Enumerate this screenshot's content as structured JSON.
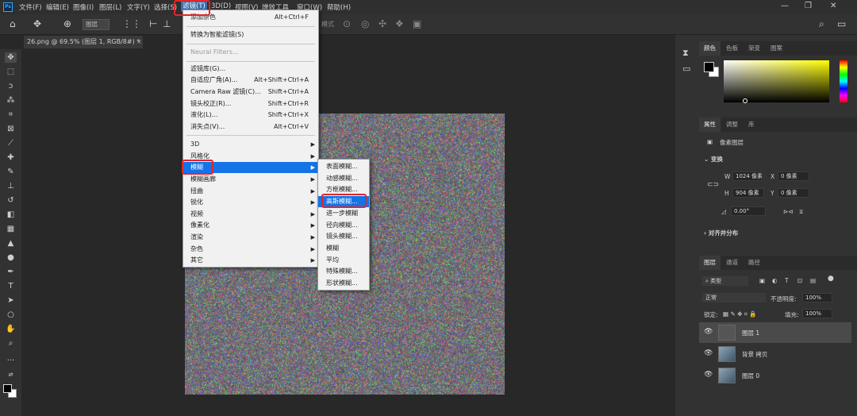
{
  "menubar": {
    "logo": "Ps",
    "items": [
      "文件(F)",
      "编辑(E)",
      "图像(I)",
      "图层(L)",
      "文字(Y)",
      "选择(S)",
      "滤镜(T)",
      "3D(D)",
      "视图(V)",
      "增效工具",
      "窗口(W)",
      "帮助(H)"
    ]
  },
  "options": {
    "sel1": "图层",
    "mode_label": "模式"
  },
  "document": {
    "tab": "26.png @ 69.5% (图层 1, RGB/8#) *",
    "close": "×"
  },
  "filter_menu": {
    "items": [
      {
        "label": "添加杂色",
        "shortcut": "Alt+Ctrl+F"
      },
      {
        "label": "转换为智能滤镜(S)",
        "shortcut": ""
      },
      {
        "label": "Neural Filters...",
        "shortcut": ""
      },
      {
        "label": "滤镜库(G)...",
        "shortcut": ""
      },
      {
        "label": "自适应广角(A)...",
        "shortcut": "Alt+Shift+Ctrl+A"
      },
      {
        "label": "Camera Raw 滤镜(C)...",
        "shortcut": "Shift+Ctrl+A"
      },
      {
        "label": "镜头校正(R)...",
        "shortcut": "Shift+Ctrl+R"
      },
      {
        "label": "液化(L)...",
        "shortcut": "Shift+Ctrl+X"
      },
      {
        "label": "消失点(V)...",
        "shortcut": "Alt+Ctrl+V"
      },
      {
        "label": "3D",
        "shortcut": ""
      },
      {
        "label": "风格化",
        "shortcut": ""
      },
      {
        "label": "模糊",
        "shortcut": ""
      },
      {
        "label": "模糊画廊",
        "shortcut": ""
      },
      {
        "label": "扭曲",
        "shortcut": ""
      },
      {
        "label": "锐化",
        "shortcut": ""
      },
      {
        "label": "视频",
        "shortcut": ""
      },
      {
        "label": "像素化",
        "shortcut": ""
      },
      {
        "label": "渲染",
        "shortcut": ""
      },
      {
        "label": "杂色",
        "shortcut": ""
      },
      {
        "label": "其它",
        "shortcut": ""
      }
    ]
  },
  "blur_submenu": {
    "items": [
      "表面模糊...",
      "动感模糊...",
      "方框模糊...",
      "高斯模糊...",
      "进一步模糊",
      "径向模糊...",
      "镜头模糊...",
      "模糊",
      "平均",
      "特殊模糊...",
      "形状模糊..."
    ]
  },
  "color_panel": {
    "tabs": [
      "颜色",
      "色板",
      "渐变",
      "图案"
    ]
  },
  "properties_panel": {
    "tabs": [
      "属性",
      "调整",
      "库"
    ],
    "type": "像素图层",
    "transform": "变换",
    "w": "1024 像素",
    "h": "904 像素",
    "x": "0 像素",
    "y": "0 像素",
    "w_label": "W",
    "h_label": "H",
    "x_label": "X",
    "y_label": "Y",
    "angle": "0.00°",
    "align": "对齐并分布"
  },
  "layers_panel": {
    "tabs": [
      "图层",
      "通道",
      "路径"
    ],
    "kind": "类型",
    "blend": "正常",
    "opacity_label": "不透明度:",
    "opacity": "100%",
    "lock_label": "锁定:",
    "fill_label": "填充:",
    "fill": "100%",
    "layers": [
      "图层 1",
      "背景 拷贝",
      "图层 0"
    ]
  },
  "colors": {
    "highlight": "#1473e6",
    "annotation": "#e0262c"
  }
}
